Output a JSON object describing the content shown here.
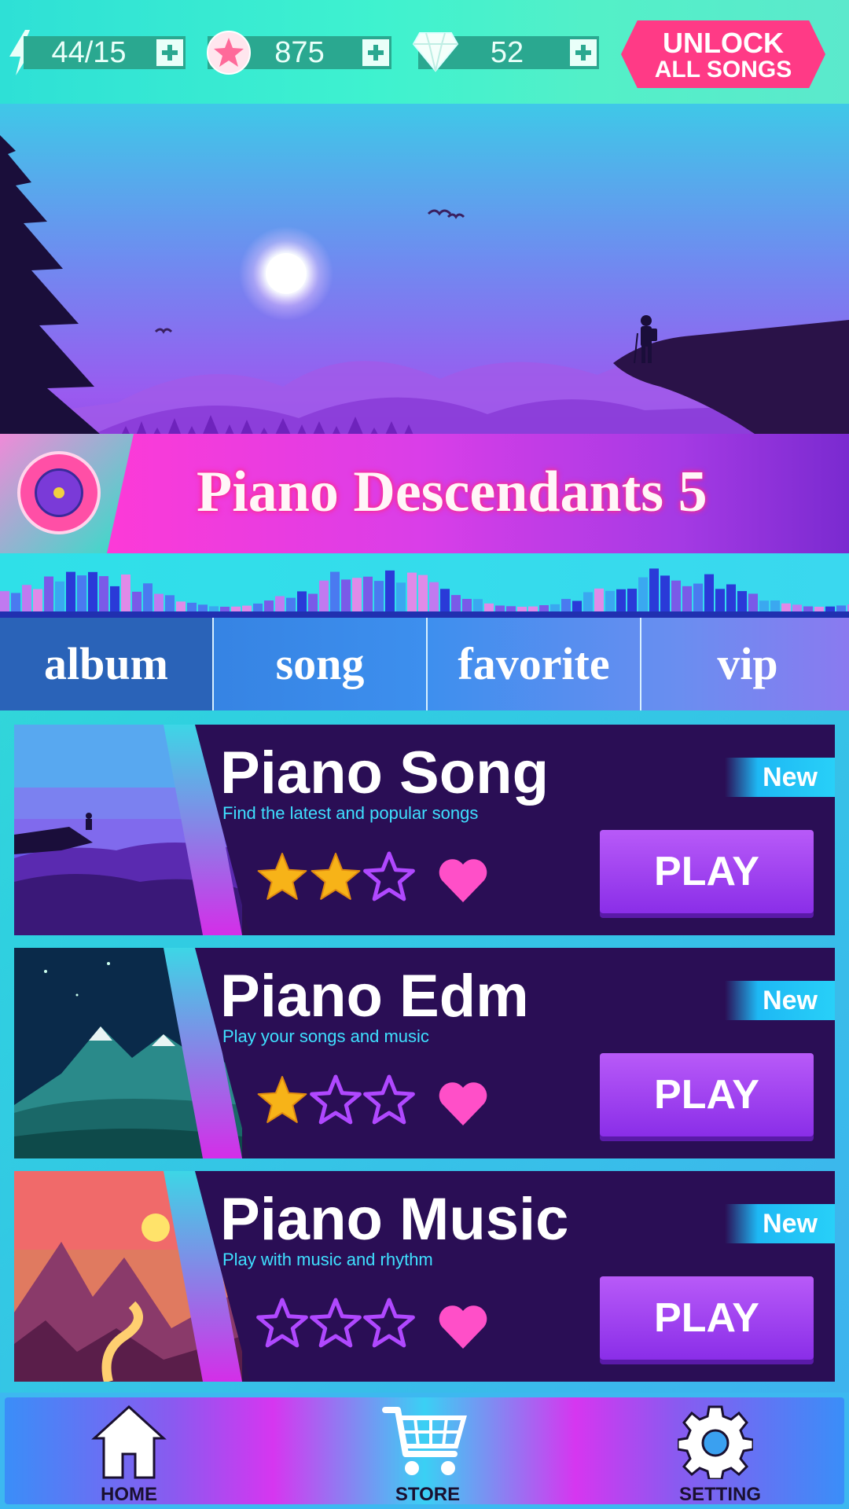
{
  "topbar": {
    "energy": {
      "value": "44/15",
      "icon": "lightning-icon"
    },
    "stars": {
      "value": "875",
      "icon": "star-coin-icon"
    },
    "gems": {
      "value": "52",
      "icon": "diamond-icon"
    },
    "unlock": {
      "line1": "UNLOCK",
      "line2": "ALL SONGS"
    }
  },
  "album": {
    "title": "Piano Descendants 5",
    "icon": "vinyl-disc-icon"
  },
  "tabs": [
    {
      "label": "album",
      "active": true
    },
    {
      "label": "song",
      "active": false
    },
    {
      "label": "favorite",
      "active": false
    },
    {
      "label": "vip",
      "active": false
    }
  ],
  "cards": [
    {
      "name": "Piano Song",
      "desc": "Find the latest and popular songs",
      "badge": "New",
      "stars": 2,
      "max_stars": 3,
      "play": "PLAY"
    },
    {
      "name": "Piano Edm",
      "desc": "Play your songs and music",
      "badge": "New",
      "stars": 1,
      "max_stars": 3,
      "play": "PLAY"
    },
    {
      "name": "Piano Music",
      "desc": "Play with music and rhythm",
      "badge": "New",
      "stars": 0,
      "max_stars": 3,
      "play": "PLAY"
    }
  ],
  "nav": {
    "home": "HOME",
    "store": "STORE",
    "setting": "SETTING"
  },
  "colors": {
    "accent": "#ff3a86",
    "play": "#9a3ef0",
    "star": "#f7b318",
    "heart": "#ff4fc8"
  }
}
